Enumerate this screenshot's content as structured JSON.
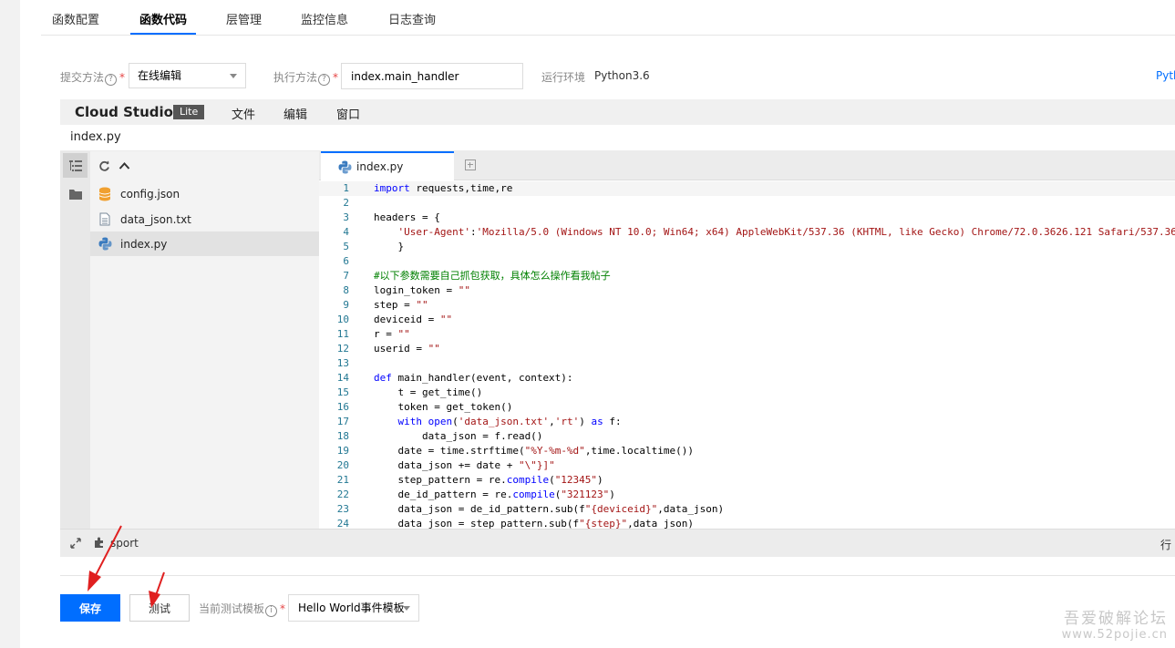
{
  "tabs": [
    {
      "label": "函数配置"
    },
    {
      "label": "函数代码"
    },
    {
      "label": "层管理"
    },
    {
      "label": "监控信息"
    },
    {
      "label": "日志查询"
    }
  ],
  "config": {
    "submit_label": "提交方法",
    "submit_value": "在线编辑",
    "handler_label": "执行方法",
    "handler_value": "index.main_handler",
    "runtime_label": "运行环境",
    "runtime_value": "Python3.6",
    "doc_link": "Pyth"
  },
  "studio": {
    "brand": "Cloud Studio",
    "badge": "Lite",
    "menu": [
      "文件",
      "编辑",
      "窗口"
    ],
    "file_title": "index.py"
  },
  "explorer": {
    "files": [
      {
        "name": "config.json",
        "icon": "database-icon"
      },
      {
        "name": "data_json.txt",
        "icon": "document-icon"
      },
      {
        "name": "index.py",
        "icon": "python-icon"
      }
    ]
  },
  "editor": {
    "tab_label": "index.py",
    "lines": [
      "import requests,time,re",
      "",
      "headers = {",
      "    'User-Agent':'Mozilla/5.0 (Windows NT 10.0; Win64; x64) AppleWebKit/537.36 (KHTML, like Gecko) Chrome/72.0.3626.121 Safari/537.36'",
      "    }",
      "",
      "#以下参数需要自己抓包获取，具体怎么操作看我帖子",
      "login_token = \"\"",
      "step = \"\"",
      "deviceid = \"\"",
      "r = \"\"",
      "userid = \"\"",
      "",
      "def main_handler(event, context):",
      "    t = get_time()",
      "    token = get_token()",
      "    with open('data_json.txt','rt') as f:",
      "        data_json = f.read()",
      "    date = time.strftime(\"%Y-%m-%d\",time.localtime())",
      "    data_json += date + \"\\\"}]\"",
      "    step_pattern = re.compile(\"12345\")",
      "    de_id_pattern = re.compile(\"321123\")",
      "    data_json = de_id_pattern.sub(f\"{deviceid}\",data_json)",
      "    data_json = step_pattern.sub(f\"{step}\",data_json)"
    ]
  },
  "statusbar": {
    "text": "sport",
    "right": "行"
  },
  "actions": {
    "save": "保存",
    "test": "测试",
    "template_label": "当前测试模板",
    "template_value": "Hello World事件模板"
  },
  "watermark": {
    "line1": "吾爱破解论坛",
    "line2": "www.52pojie.cn"
  },
  "colors": {
    "accent": "#006eff",
    "annotation_arrow": "#e02020"
  }
}
